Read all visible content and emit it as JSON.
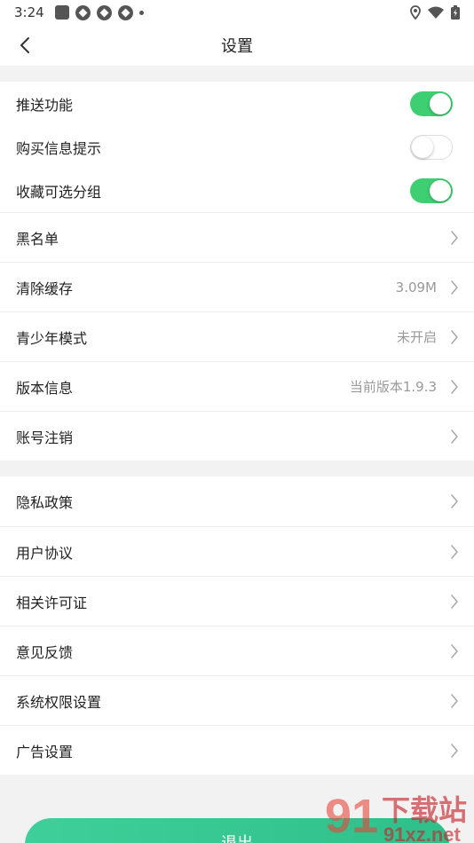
{
  "status_bar": {
    "time": "3:24"
  },
  "header": {
    "title": "设置"
  },
  "switches": [
    {
      "label": "推送功能",
      "on": true
    },
    {
      "label": "购买信息提示",
      "on": false
    },
    {
      "label": "收藏可选分组",
      "on": true
    }
  ],
  "group1": [
    {
      "label": "黑名单",
      "value": ""
    },
    {
      "label": "清除缓存",
      "value": "3.09M"
    },
    {
      "label": "青少年模式",
      "value": "未开启"
    },
    {
      "label": "版本信息",
      "value": "当前版本1.9.3"
    },
    {
      "label": "账号注销",
      "value": ""
    }
  ],
  "group2": [
    {
      "label": "隐私政策"
    },
    {
      "label": "用户协议"
    },
    {
      "label": "相关许可证"
    },
    {
      "label": "意见反馈"
    },
    {
      "label": "系统权限设置"
    },
    {
      "label": "广告设置"
    }
  ],
  "logout_label": "退出",
  "watermark": {
    "number": "91",
    "text_top": "下载站",
    "text_bottom": "91xz.net"
  },
  "colors": {
    "accent": "#3ecf72",
    "logout": "#3ecf9a"
  }
}
